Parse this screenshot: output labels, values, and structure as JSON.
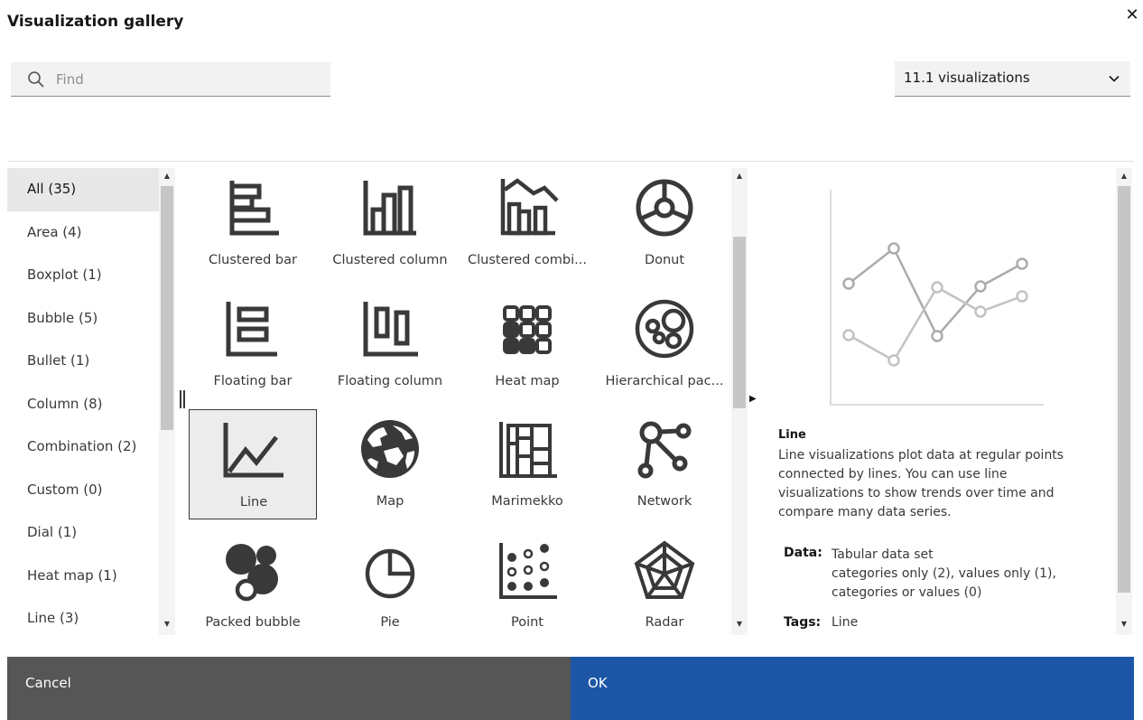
{
  "dialog": {
    "title": "Visualization gallery",
    "close_icon": "close-icon"
  },
  "search": {
    "placeholder": "Find",
    "value": "",
    "icon": "search-icon"
  },
  "version_select": {
    "value": "11.1 visualizations",
    "icon": "chevron-down-icon"
  },
  "categories": [
    {
      "label": "All (35)",
      "active": true
    },
    {
      "label": "Area (4)"
    },
    {
      "label": "Boxplot (1)"
    },
    {
      "label": "Bubble (5)"
    },
    {
      "label": "Bullet (1)"
    },
    {
      "label": "Column (8)"
    },
    {
      "label": "Combination (2)"
    },
    {
      "label": "Custom (0)"
    },
    {
      "label": "Dial (1)"
    },
    {
      "label": "Heat map (1)"
    },
    {
      "label": "Line (3)"
    }
  ],
  "visualizations": [
    {
      "label": "Clustered bar",
      "icon": "clustered-bar-icon"
    },
    {
      "label": "Clustered column",
      "icon": "clustered-column-icon"
    },
    {
      "label": "Clustered combi...",
      "icon": "clustered-combination-icon"
    },
    {
      "label": "Donut",
      "icon": "donut-icon"
    },
    {
      "label": "Floating bar",
      "icon": "floating-bar-icon"
    },
    {
      "label": "Floating column",
      "icon": "floating-column-icon"
    },
    {
      "label": "Heat map",
      "icon": "heat-map-icon"
    },
    {
      "label": "Hierarchical pac...",
      "icon": "hierarchical-packed-bubble-icon"
    },
    {
      "label": "Line",
      "icon": "line-chart-icon",
      "selected": true
    },
    {
      "label": "Map",
      "icon": "globe-icon"
    },
    {
      "label": "Marimekko",
      "icon": "marimekko-icon"
    },
    {
      "label": "Network",
      "icon": "network-icon"
    },
    {
      "label": "Packed bubble",
      "icon": "packed-bubble-icon"
    },
    {
      "label": "Pie",
      "icon": "pie-icon"
    },
    {
      "label": "Point",
      "icon": "point-icon"
    },
    {
      "label": "Radar",
      "icon": "radar-icon"
    }
  ],
  "details": {
    "preview_icon": "line-chart-preview",
    "name": "Line",
    "description": "Line visualizations plot data at regular points connected by lines. You can use line visualizations to show trends over time and compare many data series.",
    "data_label": "Data:",
    "data_line1": "Tabular data set",
    "data_line2": "categories only (2),  values only (1),",
    "data_line3": "categories or values (0)",
    "tags_label": "Tags:",
    "tags_value": "Line"
  },
  "footer": {
    "cancel_label": "Cancel",
    "ok_label": "OK"
  },
  "colors": {
    "primary": "#1d56a6",
    "secondary": "#565656",
    "icon": "#393939"
  }
}
